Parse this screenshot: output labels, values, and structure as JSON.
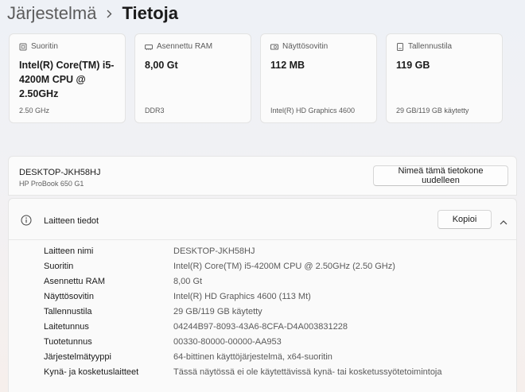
{
  "breadcrumb": {
    "parent": "Järjestelmä",
    "current": "Tietoja"
  },
  "cards": [
    {
      "icon": "cpu-icon",
      "label": "Suoritin",
      "value": "Intel(R) Core(TM) i5-4200M CPU @ 2.50GHz",
      "sub": "2.50 GHz"
    },
    {
      "icon": "ram-icon",
      "label": "Asennettu RAM",
      "value": "8,00 Gt",
      "sub": "DDR3"
    },
    {
      "icon": "gpu-icon",
      "label": "Näyttösovitin",
      "value": "112 MB",
      "sub": "Intel(R) HD Graphics 4600"
    },
    {
      "icon": "storage-icon",
      "label": "Tallennustila",
      "value": "119 GB",
      "sub": "29 GB/119 GB käytetty"
    }
  ],
  "device": {
    "name": "DESKTOP-JKH58HJ",
    "model": "HP ProBook 650 G1",
    "rename_label": "Nimeä tämä tietokone uudelleen"
  },
  "specs": {
    "title": "Laitteen tiedot",
    "copy_label": "Kopioi",
    "rows": [
      {
        "label": "Laitteen nimi",
        "value": "DESKTOP-JKH58HJ"
      },
      {
        "label": "Suoritin",
        "value": "Intel(R) Core(TM) i5-4200M CPU @ 2.50GHz (2.50 GHz)"
      },
      {
        "label": "Asennettu RAM",
        "value": "8,00 Gt"
      },
      {
        "label": "Näyttösovitin",
        "value": "Intel(R) HD Graphics 4600 (113 Mt)"
      },
      {
        "label": "Tallennustila",
        "value": "29 GB/119 GB käytetty"
      },
      {
        "label": "Laitetunnus",
        "value": "04244B97-8093-43A6-8CFA-D4A003831228"
      },
      {
        "label": "Tuotetunnus",
        "value": "00330-80000-00000-AA953"
      },
      {
        "label": "Järjestelmätyyppi",
        "value": "64-bittinen käyttöjärjestelmä, x64-suoritin"
      },
      {
        "label": "Kynä- ja kosketuslaitteet",
        "value": "Tässä näytössä ei ole käytettävissä kynä- tai kosketussyötetoimintoja"
      }
    ]
  }
}
